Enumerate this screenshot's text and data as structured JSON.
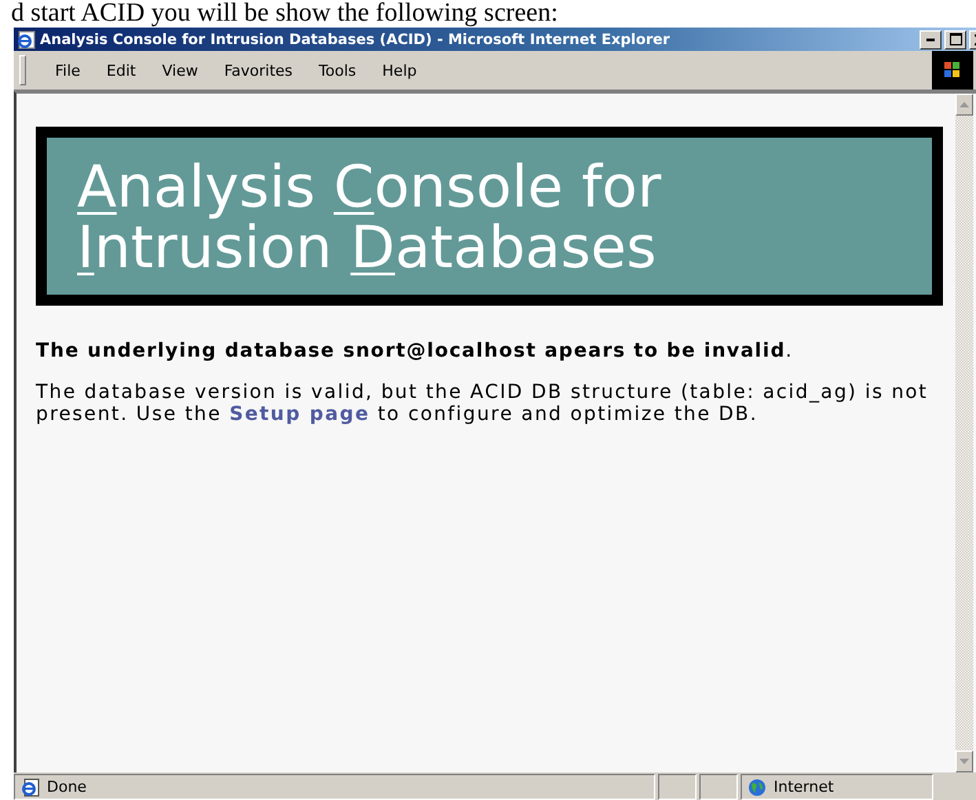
{
  "caption": "d start ACID you will be show the following screen:",
  "window": {
    "title": "Analysis Console for Intrusion Databases (ACID) - Microsoft Internet Explorer"
  },
  "menu": [
    "File",
    "Edit",
    "View",
    "Favorites",
    "Tools",
    "Help"
  ],
  "banner": {
    "lines": [
      [
        {
          "text": "A",
          "underlined": true
        },
        {
          "text": "nalysis ",
          "underlined": false
        },
        {
          "text": "C",
          "underlined": true
        },
        {
          "text": "onsole for",
          "underlined": false
        }
      ],
      [
        {
          "text": "I",
          "underlined": true
        },
        {
          "text": "ntrusion ",
          "underlined": false
        },
        {
          "text": "D",
          "underlined": true
        },
        {
          "text": "atabases",
          "underlined": false
        }
      ]
    ]
  },
  "error": "**The underlying database snort@localhost apears to be invalid**.",
  "message": {
    "before": "The database version is valid, but the ACID DB structure (table: acid_ag) is not present. Use the ",
    "link": "Setup page",
    "after": " to configure and optimize the DB."
  },
  "status_bar": {
    "text": "Done",
    "zone": "Internet"
  }
}
